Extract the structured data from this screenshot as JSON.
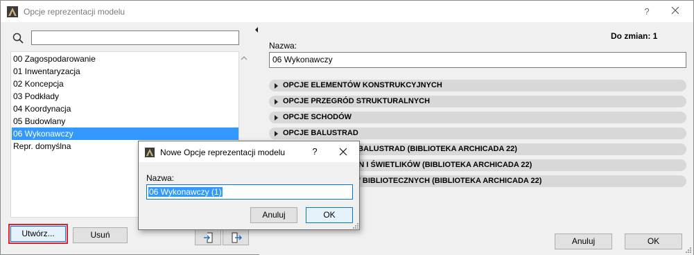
{
  "window": {
    "title": "Opcje reprezentacji modelu",
    "help_glyph": "?"
  },
  "search": {
    "value": "",
    "placeholder": ""
  },
  "list": {
    "items": [
      "00 Zagospodarowanie",
      "01 Inwentaryzacja",
      "02 Koncepcja",
      "03 Podkłady",
      "04 Koordynacja",
      "05 Budowlany",
      "06 Wykonawczy",
      "Repr. domyślna"
    ],
    "selected": "06 Wykonawczy"
  },
  "left_buttons": {
    "create": "Utwórz...",
    "delete": "Usuń"
  },
  "right": {
    "changes_label": "Do zmian: 1",
    "name_label": "Nazwa:",
    "name_value": "06 Wykonawczy",
    "sections": [
      "OPCJE ELEMENTÓW KONSTRUKCYJNYCH",
      "OPCJE PRZEGRÓD STRUKTURALNYCH",
      "OPCJE SCHODÓW",
      "OPCJE BALUSTRAD",
      "OPCJE SCHODÓW I BALUSTRAD (BIBLIOTEKA ARCHICADA 22)",
      "OPCJE DRZWI, OKIEN I ŚWIETLIKÓW (BIBLIOTEKA ARCHICADA 22)",
      "OPCJE ELEMENTÓW BIBLIOTECZNYCH (BIBLIOTEKA ARCHICADA 22)"
    ],
    "cancel": "Anuluj",
    "ok": "OK"
  },
  "modal": {
    "title": "Nowe Opcje reprezentacji modelu",
    "help_glyph": "?",
    "name_label": "Nazwa:",
    "name_value": "06 Wykonawczy (1)",
    "cancel": "Anuluj",
    "ok": "OK"
  },
  "colors": {
    "selection": "#3399ff",
    "highlight_outline": "#e0202a",
    "focus_border": "#0078d7"
  }
}
